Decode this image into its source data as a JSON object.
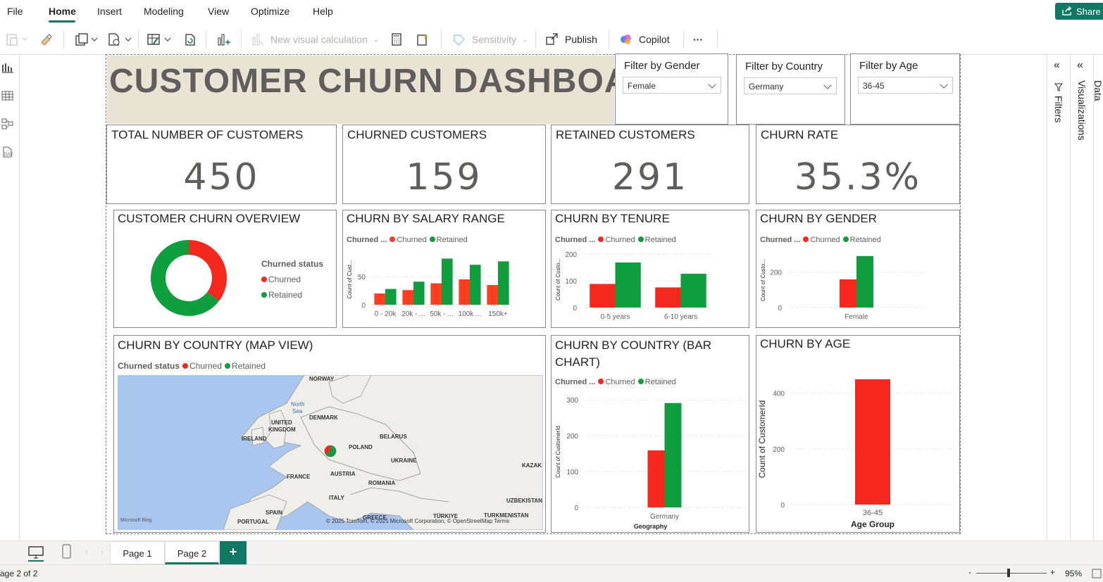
{
  "menu": {
    "items": [
      "File",
      "Home",
      "Insert",
      "Modeling",
      "View",
      "Optimize",
      "Help"
    ],
    "share": "Share"
  },
  "ribbon": {
    "new_visual_calc": "New visual calculation",
    "sensitivity": "Sensitivity",
    "publish": "Publish",
    "copilot": "Copilot",
    "more": "···"
  },
  "report": {
    "title": "CUSTOMER CHURN DASHBOARD"
  },
  "filters": {
    "gender": {
      "title": "Filter by Gender",
      "value": "Female"
    },
    "country": {
      "title": "Filter by Country",
      "value": "Germany"
    },
    "age": {
      "title": "Filter by Age",
      "value": "36-45"
    }
  },
  "kpis": {
    "total": {
      "title": "TOTAL NUMBER OF CUSTOMERS",
      "value": "450"
    },
    "churned": {
      "title": "CHURNED CUSTOMERS",
      "value": "159"
    },
    "retained": {
      "title": "RETAINED CUSTOMERS",
      "value": "291"
    },
    "rate": {
      "title": "CHURN RATE",
      "value": "35.3%"
    }
  },
  "legend": {
    "title_short": "Churned ...",
    "title_full": "Churned status",
    "churned": "Churned",
    "retained": "Retained"
  },
  "colors": {
    "churned": "#f5281e",
    "retained": "#0f9e3e",
    "churned_alt": "#ff3d1f"
  },
  "overview": {
    "title": "CUSTOMER CHURN OVERVIEW"
  },
  "map": {
    "title": "CHURN BY COUNTRY (MAP VIEW)",
    "labels": [
      "NORWAY",
      "North Sea",
      "DENMARK",
      "UNITED KINGDOM",
      "IRELAND",
      "BELARUS",
      "POLAND",
      "UKRAINE",
      "FRANCE",
      "AUSTRIA",
      "ROMANIA",
      "KAZAK",
      "ITALY",
      "SPAIN",
      "PORTUGAL",
      "GREECE",
      "TÜRKIYE",
      "TURKMENISTAN",
      "UZBEKISTAN"
    ],
    "attribution": "© 2025 TomTom, © 2025 Microsoft Corporation, © OpenStreetMap  Terms",
    "bing": "Microsoft Bing"
  },
  "chart_data": [
    {
      "type": "pie",
      "title": "CUSTOMER CHURN OVERVIEW",
      "legend_title": "Churned status",
      "categories": [
        "Churned",
        "Retained"
      ],
      "values": [
        159,
        291
      ]
    },
    {
      "type": "bar",
      "title": "CHURN BY SALARY RANGE",
      "ylabel": "Count of Cust...",
      "categories": [
        "0 - 20k",
        "20k - ...",
        "50k - ...",
        "100k ...",
        "150k+"
      ],
      "series": [
        {
          "name": "Churned",
          "values": [
            20,
            26,
            38,
            45,
            35
          ]
        },
        {
          "name": "Retained",
          "values": [
            28,
            41,
            82,
            71,
            77
          ]
        }
      ],
      "yticks": [
        0,
        50
      ],
      "ylim": [
        0,
        90
      ]
    },
    {
      "type": "bar",
      "title": "CHURN BY TENURE",
      "ylabel": "Count of Custo...",
      "categories": [
        "0-5 years",
        "6-10 years"
      ],
      "series": [
        {
          "name": "Churned",
          "values": [
            88,
            75
          ]
        },
        {
          "name": "Retained",
          "values": [
            168,
            126
          ]
        }
      ],
      "yticks": [
        0,
        100,
        200
      ],
      "ylim": [
        0,
        210
      ]
    },
    {
      "type": "bar",
      "title": "CHURN BY GENDER",
      "ylabel": "Count of Custo...",
      "categories": [
        "Female"
      ],
      "series": [
        {
          "name": "Churned",
          "values": [
            159
          ]
        },
        {
          "name": "Retained",
          "values": [
            291
          ]
        }
      ],
      "yticks": [
        0,
        200
      ],
      "ylim": [
        0,
        310
      ]
    },
    {
      "type": "bar",
      "title": "CHURN BY COUNTRY (BAR CHART)",
      "ylabel": "Count of CustomerId",
      "xlabel": "Geography",
      "categories": [
        "Germany"
      ],
      "series": [
        {
          "name": "Churned",
          "values": [
            159
          ]
        },
        {
          "name": "Retained",
          "values": [
            291
          ]
        }
      ],
      "yticks": [
        0,
        100,
        200,
        300
      ],
      "ylim": [
        0,
        310
      ]
    },
    {
      "type": "bar",
      "title": "CHURN BY AGE",
      "ylabel": "Count of CustomerId",
      "xlabel": "Age Group",
      "categories": [
        "36-45"
      ],
      "series": [
        {
          "name": "Churned",
          "values": [
            450
          ]
        }
      ],
      "yticks": [
        0,
        200,
        400
      ],
      "ylim": [
        0,
        470
      ]
    }
  ],
  "panes": {
    "filters": "Filters",
    "visualizations": "Visualizations",
    "data": "Data"
  },
  "pages": {
    "page1": "Page 1",
    "page2": "Page 2",
    "add": "+"
  },
  "status": {
    "page": "age 2 of 2",
    "zoom": "95%",
    "minus": "-",
    "plus": "+"
  }
}
